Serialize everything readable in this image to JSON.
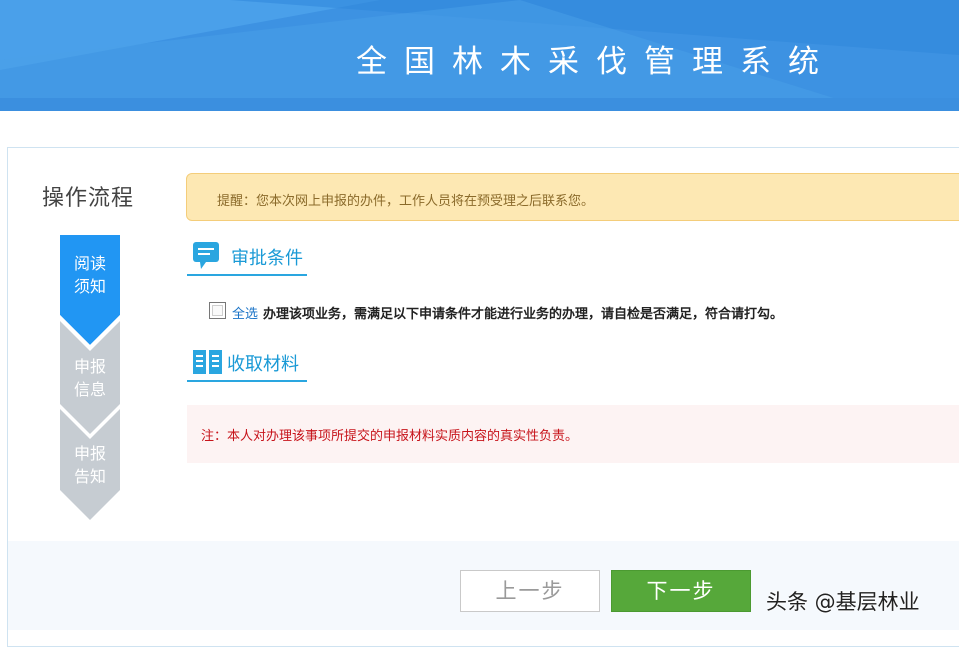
{
  "header": {
    "title": "全国林木采伐管理系统"
  },
  "flow": {
    "title": "操作流程",
    "steps": [
      {
        "line1": "阅读",
        "line2": "须知",
        "active": true
      },
      {
        "line1": "申报",
        "line2": "信息",
        "active": false
      },
      {
        "line1": "申报",
        "line2": "告知",
        "active": false
      }
    ]
  },
  "notice": {
    "text": "提醒：您本次网上申报的办件，工作人员将在预受理之后联系您。"
  },
  "approval": {
    "heading": "审批条件",
    "select_all": "全选",
    "condition_text": "办理该项业务，需满足以下申请条件才能进行业务的办理，请自检是否满足，符合请打勾。"
  },
  "materials": {
    "heading": "收取材料",
    "note": "注：本人对办理该事项所提交的申报材料实质内容的真实性负责。"
  },
  "buttons": {
    "prev": "上一步",
    "next": "下一步"
  },
  "watermark": "头条 @基层林业",
  "colors": {
    "header_blue": "#3a8fe0",
    "step_active": "#2196f3",
    "step_inactive": "#c6ccd2",
    "accent": "#1a9ad6",
    "next_green": "#56a83a",
    "warn_red": "#c7141b"
  }
}
